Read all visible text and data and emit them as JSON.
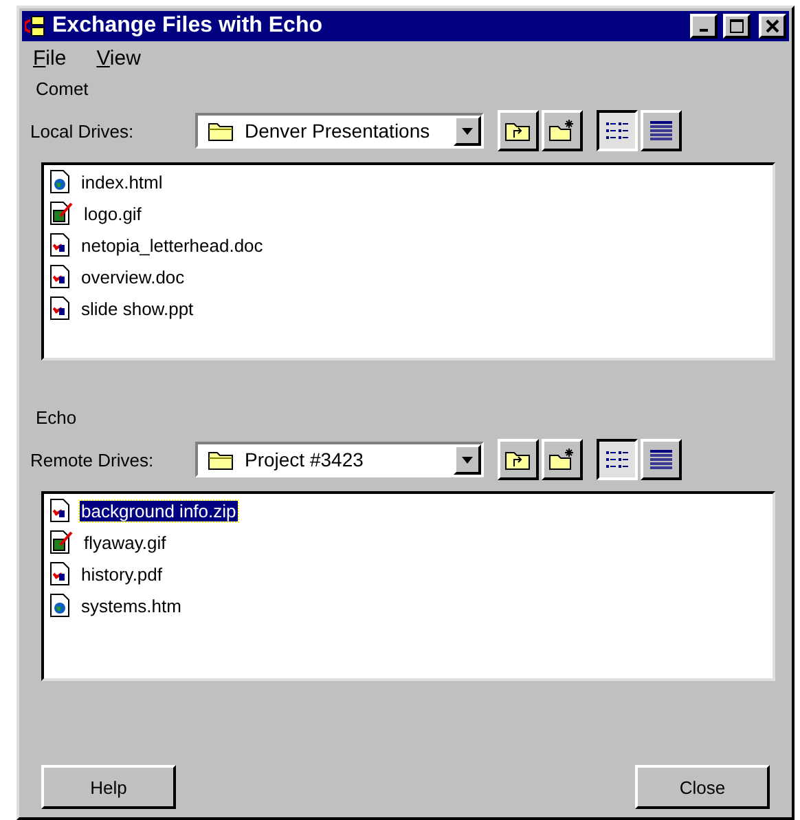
{
  "window": {
    "title": "Exchange Files with Echo"
  },
  "menu": [
    {
      "label": "File"
    },
    {
      "label": "View"
    }
  ],
  "panes": [
    {
      "label": "Comet",
      "drive_label": "Local Drives:",
      "drive": "Denver Presentations",
      "view_modes": [
        {
          "kind": "list",
          "selected": true
        },
        {
          "kind": "details",
          "selected": false
        }
      ],
      "files": [
        {
          "name": "index.html",
          "kind": "web",
          "selected": false
        },
        {
          "name": "logo.gif",
          "kind": "image",
          "selected": false
        },
        {
          "name": "netopia_letterhead.doc",
          "kind": "doc",
          "selected": false
        },
        {
          "name": "overview.doc",
          "kind": "doc",
          "selected": false
        },
        {
          "name": "slide show.ppt",
          "kind": "doc",
          "selected": false
        }
      ]
    },
    {
      "label": "Echo",
      "drive_label": "Remote Drives:",
      "drive": "Project #3423",
      "view_modes": [
        {
          "kind": "list",
          "selected": true
        },
        {
          "kind": "details",
          "selected": false
        }
      ],
      "files": [
        {
          "name": "background info.zip",
          "kind": "doc",
          "selected": true
        },
        {
          "name": "flyaway.gif",
          "kind": "image",
          "selected": false
        },
        {
          "name": "history.pdf",
          "kind": "doc",
          "selected": false
        },
        {
          "name": "systems.htm",
          "kind": "web",
          "selected": false
        }
      ]
    }
  ],
  "buttons": [
    {
      "label": "Help"
    },
    {
      "label": "Close"
    }
  ]
}
